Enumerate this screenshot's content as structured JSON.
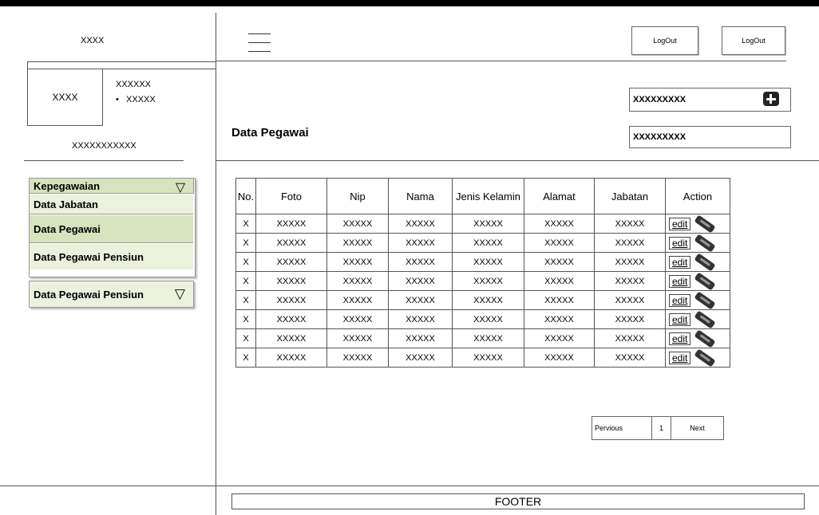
{
  "sidebar": {
    "logo_text": "XXXX",
    "avatar_text": "XXXX",
    "user_title": "XXXXXX",
    "user_bullet": "XXXXX",
    "user_id": "XXXXXXXXXXX",
    "menu": {
      "group_label": "Kepegawaian",
      "items": [
        "Data Jabatan",
        "Data Pegawai",
        "Data Pegawai Pensiun"
      ],
      "secondary_group_label": "Data Pegawai Pensiun"
    }
  },
  "header": {
    "logout_1": "LogOut",
    "logout_2": "LogOut"
  },
  "main": {
    "page_title": "Data Pegawai",
    "input_top": "XXXXXXXXX",
    "input_bottom": "XXXXXXXXX"
  },
  "table": {
    "headers": [
      "No.",
      "Foto",
      "Nip",
      "Nama",
      "Jenis Kelamin",
      "Alamat",
      "Jabatan",
      "Action"
    ],
    "rows": [
      [
        "X",
        "XXXXX",
        "XXXXX",
        "XXXXX",
        "XXXXX",
        "XXXXX",
        "XXXXX"
      ],
      [
        "X",
        "XXXXX",
        "XXXXX",
        "XXXXX",
        "XXXXX",
        "XXXXX",
        "XXXXX"
      ],
      [
        "X",
        "XXXXX",
        "XXXXX",
        "XXXXX",
        "XXXXX",
        "XXXXX",
        "XXXXX"
      ],
      [
        "X",
        "XXXXX",
        "XXXXX",
        "XXXXX",
        "XXXXX",
        "XXXXX",
        "XXXXX"
      ],
      [
        "X",
        "XXXXX",
        "XXXXX",
        "XXXXX",
        "XXXXX",
        "XXXXX",
        "XXXXX"
      ],
      [
        "X",
        "XXXXX",
        "XXXXX",
        "XXXXX",
        "XXXXX",
        "XXXXX",
        "XXXXX"
      ],
      [
        "X",
        "XXXXX",
        "XXXXX",
        "XXXXX",
        "XXXXX",
        "XXXXX",
        "XXXXX"
      ],
      [
        "X",
        "XXXXX",
        "XXXXX",
        "XXXXX",
        "XXXXX",
        "XXXXX",
        "XXXXX"
      ]
    ],
    "edit_label": "edit"
  },
  "pagination": {
    "previous": "Pervious",
    "page": "1",
    "next": "Next"
  },
  "footer": {
    "label": "FOOTER"
  },
  "colors": {
    "menu_header": "#d6e3bc",
    "menu_item": "#ebf1dd",
    "menu_active": "#d6e3bc"
  }
}
